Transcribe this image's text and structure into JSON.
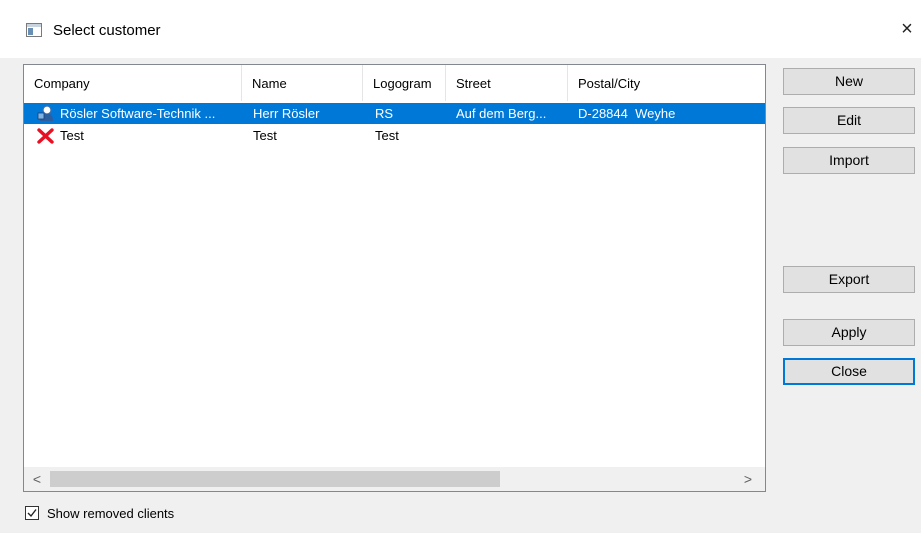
{
  "window": {
    "title": "Select customer",
    "close_glyph": "×"
  },
  "table": {
    "columns": [
      "Company",
      "Name",
      "Logogram",
      "Street",
      "Postal/City"
    ],
    "rows": [
      {
        "icon": "customer-icon",
        "company": "Rösler Software-Technik ...",
        "name": "Herr Rösler",
        "logogram": "RS",
        "street": "Auf dem Berg...",
        "postal_city": "D-28844  Weyhe",
        "selected": true
      },
      {
        "icon": "removed-x-icon",
        "company": "Test",
        "name": "Test",
        "logogram": "Test",
        "street": "",
        "postal_city": "",
        "selected": false
      }
    ]
  },
  "buttons": {
    "new": "New",
    "edit": "Edit",
    "import": "Import",
    "export": "Export",
    "apply": "Apply",
    "close": "Close"
  },
  "scrollbar": {
    "left": "<",
    "right": ">"
  },
  "footer": {
    "show_removed_label": "Show removed clients",
    "show_removed_checked": true
  },
  "colors": {
    "selection": "#0078d7",
    "removed_x": "#e81123"
  }
}
